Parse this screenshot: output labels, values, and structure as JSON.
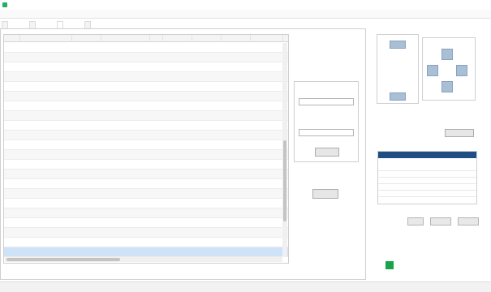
{
  "window": {
    "title": "",
    "minimize_glyph": "",
    "maximize_glyph": "",
    "close_glyph": ""
  },
  "menu": [
    "",
    ""
  ],
  "tabs": [
    "",
    "",
    "",
    ""
  ],
  "grid": {
    "columns": [
      "",
      "",
      "",
      "",
      "",
      "",
      "",
      "",
      ""
    ],
    "rows": [
      [
        "",
        "",
        "",
        "",
        "",
        "",
        ""
      ],
      [
        "",
        "",
        "",
        "",
        "",
        "",
        ""
      ],
      [
        "",
        "",
        "",
        "",
        "",
        "",
        ""
      ],
      [
        "",
        "",
        "",
        "",
        "",
        "",
        ""
      ],
      [
        "",
        "",
        "",
        "",
        "",
        "",
        ""
      ],
      [
        "",
        "",
        "",
        "",
        "",
        "",
        ""
      ],
      [
        "",
        "",
        "",
        "",
        "",
        "",
        ""
      ],
      [
        "",
        "",
        "",
        "",
        "",
        "",
        ""
      ],
      [
        "",
        "",
        "",
        "",
        "",
        "",
        ""
      ],
      [
        "",
        "",
        "",
        "",
        "",
        "",
        ""
      ],
      [
        "",
        "",
        "",
        "",
        "",
        "",
        ""
      ],
      [
        "",
        "",
        "",
        "",
        "",
        "",
        ""
      ],
      [
        "",
        "",
        "",
        "",
        "",
        "",
        ""
      ],
      [
        "",
        "",
        "",
        "",
        "",
        "",
        ""
      ],
      [
        "",
        "",
        "",
        "",
        "",
        "",
        ""
      ],
      [
        "",
        "",
        "",
        "",
        "",
        "",
        ""
      ],
      [
        "",
        "",
        "",
        "",
        "",
        "",
        ""
      ],
      [
        "",
        "",
        "",
        "",
        "",
        "",
        ""
      ],
      [
        "",
        "",
        "",
        "",
        "",
        "",
        ""
      ],
      [
        "",
        "",
        "",
        "",
        "",
        "",
        ""
      ],
      [
        "",
        "",
        "",
        "",
        "",
        "",
        ""
      ],
      [
        "",
        "",
        "",
        "",
        "",
        "",
        ""
      ]
    ]
  },
  "query": {
    "group_title": "",
    "start_label": "",
    "start_value": "",
    "end_label": "",
    "end_value": "",
    "query_button": "",
    "export_button": ""
  },
  "runtime": {
    "label": "",
    "hours": "",
    "hours_unit": "",
    "minutes": "",
    "minutes_unit": "",
    "seconds_unit": ""
  },
  "move": {
    "group_title": "",
    "btn_primary": "",
    "dim1": "",
    "dim2": "",
    "dim3": "",
    "btn_stop": ""
  },
  "direction": {
    "group_title": "",
    "up": "",
    "left": "",
    "right": "",
    "down": ""
  },
  "alarm_settings": {
    "title": "",
    "high_label": "",
    "high_value": "",
    "low_label": "",
    "low_value": "",
    "setting_label": "",
    "open_button": ""
  },
  "alarm_info": {
    "title": "",
    "col_alarm": "",
    "col_type": ""
  },
  "port": {
    "name": "",
    "btn_connect": "",
    "btn_close": "",
    "btn_shut": ""
  },
  "sensor": {
    "title": "",
    "temp_label": "",
    "temp_value": "",
    "humidity_label": "",
    "humidity_value": "",
    "value1": "",
    "value2": "",
    "value3": ""
  },
  "colors": {
    "status_green": "#19a34a",
    "header_blue": "#1f4f82"
  }
}
